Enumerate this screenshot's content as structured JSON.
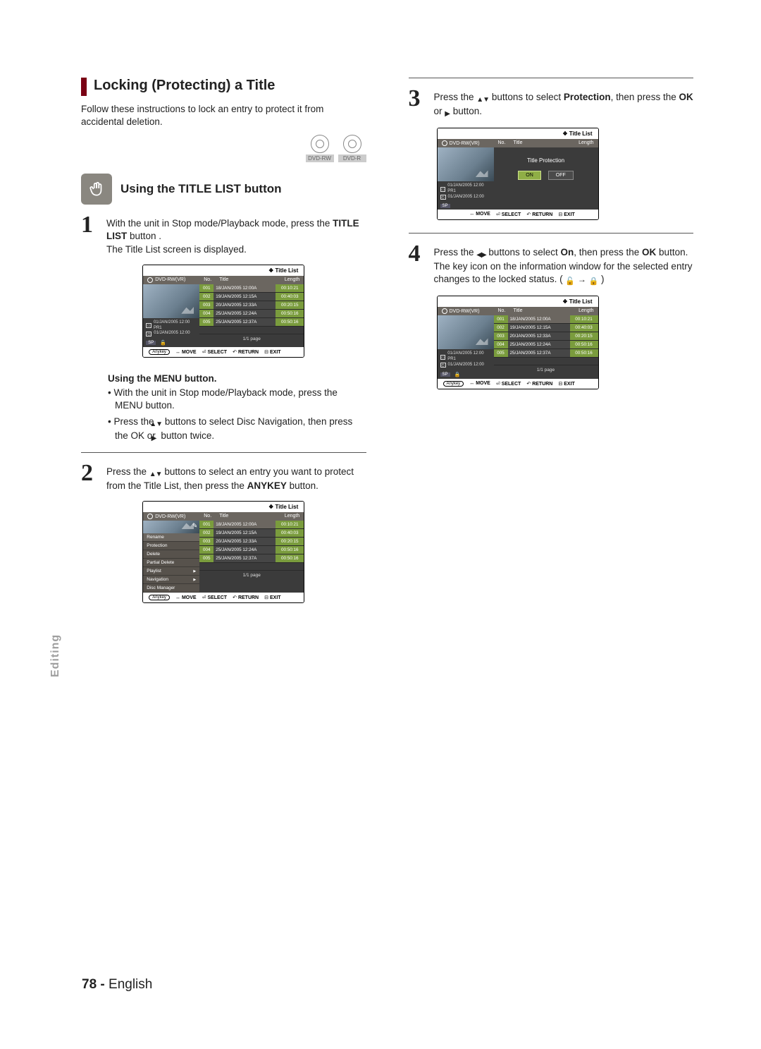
{
  "section": {
    "title": "Locking (Protecting) a Title",
    "intro": "Follow these instructions to lock an entry to protect it from accidental deletion."
  },
  "disc_icons": [
    "DVD-RW",
    "DVD-R"
  ],
  "subhead": "Using the TITLE LIST button",
  "steps": {
    "s1a": "With the unit in Stop mode/Playback mode, press the ",
    "s1b": "TITLE LIST",
    "s1c": " button .",
    "s1d": "The Title List screen is displayed.",
    "menuhead": "Using the MENU button.",
    "m1a": "With the unit in Stop mode/Playback mode, press the ",
    "m1b": "MENU",
    "m1c": " button.",
    "m2a": "Press the ",
    "m2b": " buttons to select ",
    "m2c": "Disc Navigation",
    "m2d": ", then press the ",
    "m2e": "OK",
    "m2f": " or ",
    "m2g": " button twice.",
    "s2a": "Press the ",
    "s2b": " buttons to select an entry you want to protect from the Title List, then press the ",
    "s2c": "ANYKEY",
    "s2d": " button.",
    "s3a": "Press the ",
    "s3b": " buttons to select ",
    "s3c": "Protection",
    "s3d": ", then press the ",
    "s3e": "OK",
    "s3f": " or ",
    "s3g": " button.",
    "s4a": "Press the ",
    "s4b": " buttons to select ",
    "s4c": "On",
    "s4d": ", then press the ",
    "s4e": "OK",
    "s4f": " button. The key icon on the information window for the selected entry changes to the locked status. ( ",
    "s4g": " )"
  },
  "ui_common": {
    "title": "Title List",
    "disc": "DVD-RW(VR)",
    "hdr_no": "No.",
    "hdr_title": "Title",
    "hdr_len": "Length",
    "info_line1": "01/JAN/2005 12:00 PR1",
    "info_line2": "01/JAN/2005 12:00",
    "sp": "SP",
    "pager": "1/1 page",
    "anykey": "Anykey",
    "move": "MOVE",
    "select": "SELECT",
    "return": "RETURN",
    "exit": "EXIT"
  },
  "rows": [
    {
      "no": "001",
      "title": "18/JAN/2005 12:00A",
      "len": "00:10:21"
    },
    {
      "no": "002",
      "title": "19/JAN/2005 12:15A",
      "len": "00:40:03"
    },
    {
      "no": "003",
      "title": "20/JAN/2005 12:33A",
      "len": "00:20:15"
    },
    {
      "no": "004",
      "title": "25/JAN/2005 12:24A",
      "len": "00:50:16"
    },
    {
      "no": "005",
      "title": "25/JAN/2005 12:37A",
      "len": "00:50:16"
    }
  ],
  "anykey_menu": [
    "Rename",
    "Protection",
    "Delete",
    "Partial Delete",
    "Playlist",
    "Navigation",
    "Disc Manager"
  ],
  "protection_dialog": {
    "label": "Title Protection",
    "on": "ON",
    "off": "OFF"
  },
  "side_label": "Editing",
  "footer": {
    "page": "78 -",
    "lang": "English"
  }
}
